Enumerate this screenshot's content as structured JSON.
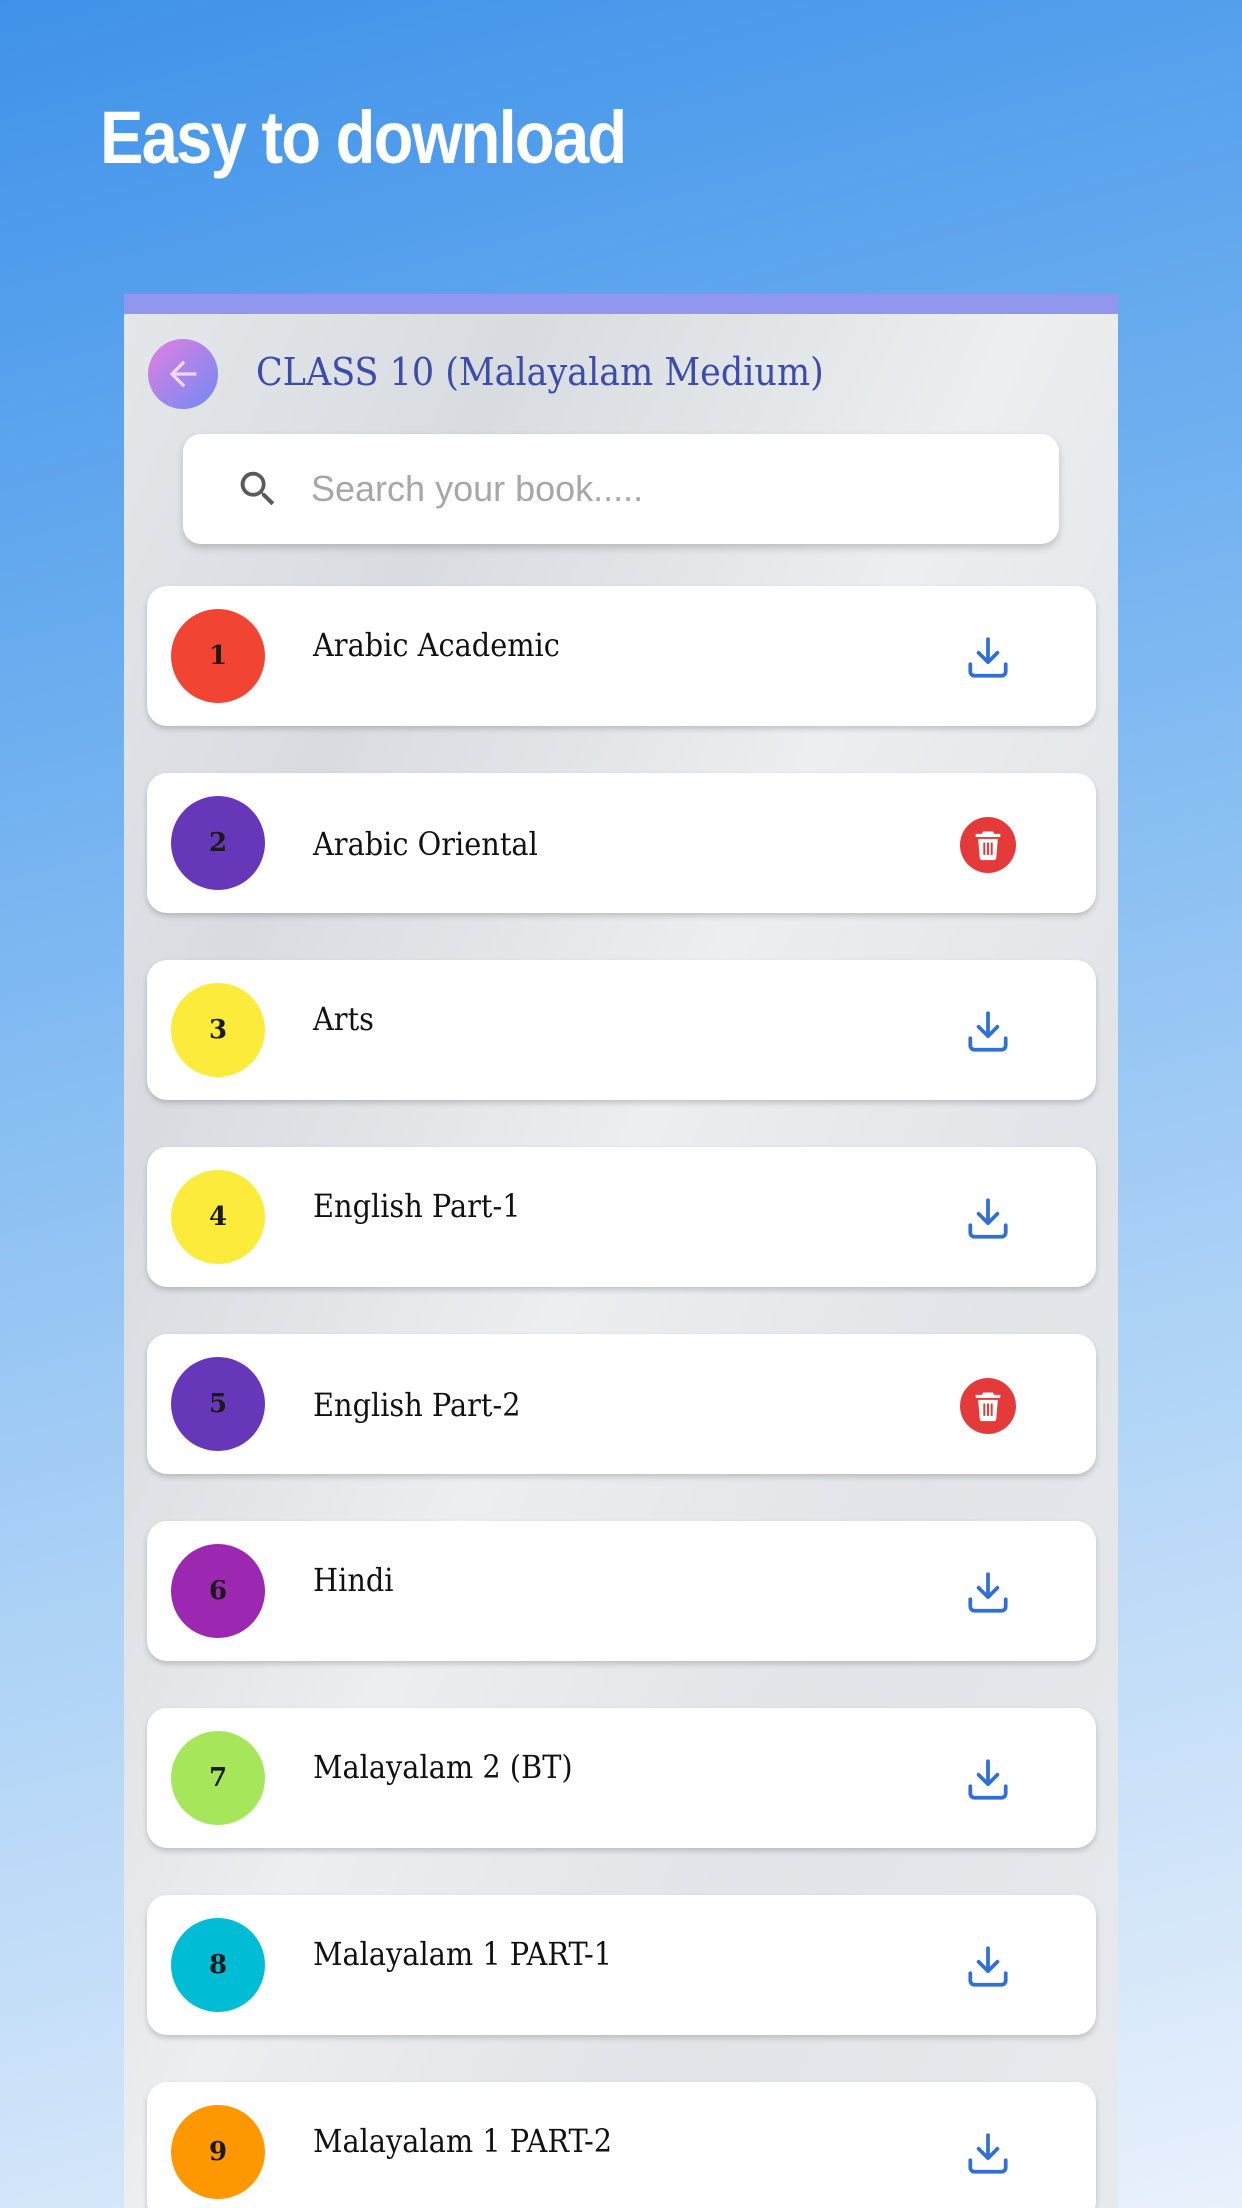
{
  "hero": {
    "title": "Easy to download"
  },
  "header": {
    "title": "CLASS 10 (Malayalam Medium)"
  },
  "search": {
    "placeholder": "Search your book....."
  },
  "colors": {
    "accent_text": "#3a4da8",
    "download_icon": "#2f6fd6",
    "delete_button": "#e53a3a"
  },
  "books": [
    {
      "number": "1",
      "name": "Arabic Academic",
      "color": "#f24433",
      "action": "download",
      "action_icon": "download-icon"
    },
    {
      "number": "2",
      "name": "Arabic Oriental",
      "color": "#6638b9",
      "action": "delete",
      "action_icon": "trash-icon"
    },
    {
      "number": "3",
      "name": "Arts",
      "color": "#fceb3a",
      "action": "download",
      "action_icon": "download-icon"
    },
    {
      "number": "4",
      "name": "English Part-1",
      "color": "#fceb3a",
      "action": "download",
      "action_icon": "download-icon"
    },
    {
      "number": "5",
      "name": "English Part-2",
      "color": "#6638b9",
      "action": "delete",
      "action_icon": "trash-icon"
    },
    {
      "number": "6",
      "name": "Hindi",
      "color": "#9c27b0",
      "action": "download",
      "action_icon": "download-icon"
    },
    {
      "number": "7",
      "name": "Malayalam 2 (BT)",
      "color": "#a5e65b",
      "action": "download",
      "action_icon": "download-icon"
    },
    {
      "number": "8",
      "name": "Malayalam 1 PART-1",
      "color": "#00bcd4",
      "action": "download",
      "action_icon": "download-icon"
    },
    {
      "number": "9",
      "name": "Malayalam 1 PART-2",
      "color": "#ff9800",
      "action": "download",
      "action_icon": "download-icon"
    }
  ]
}
